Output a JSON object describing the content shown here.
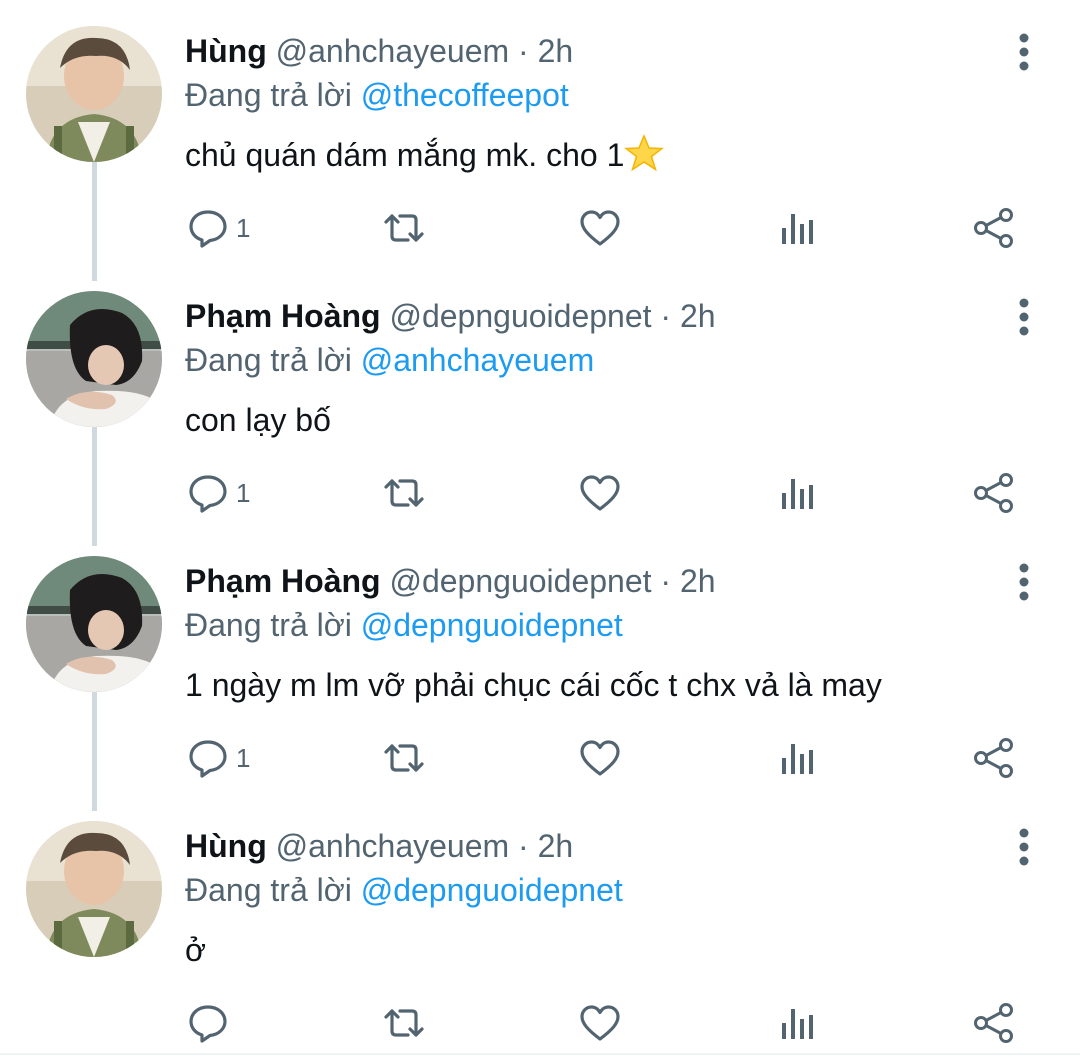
{
  "colors": {
    "text": "#0f1419",
    "secondary": "#536471",
    "link": "#1d9bf0",
    "thread_line": "#cfd9de"
  },
  "tweets": [
    {
      "name": "Hùng",
      "handle": "@anhchayeuem",
      "separator": "·",
      "time": "2h",
      "reply_prefix": "Đang trả lời",
      "reply_to": "@thecoffeepot",
      "text": "chủ quán dám mắng mk. cho 1",
      "text_emoji": "star-emoji",
      "reply_count": "1",
      "avatar": "avatar-hung"
    },
    {
      "name": "Phạm Hoàng",
      "handle": "@depnguoidepnet",
      "separator": "·",
      "time": "2h",
      "reply_prefix": "Đang trả lời",
      "reply_to": "@anhchayeuem",
      "text": "con lạy bố",
      "reply_count": "1",
      "avatar": "avatar-pham-hoang"
    },
    {
      "name": "Phạm Hoàng",
      "handle": "@depnguoidepnet",
      "separator": "·",
      "time": "2h",
      "reply_prefix": "Đang trả lời",
      "reply_to": "@depnguoidepnet",
      "text": "1 ngày m lm vỡ phải chục cái cốc t chx vả là may",
      "reply_count": "1",
      "avatar": "avatar-pham-hoang"
    },
    {
      "name": "Hùng",
      "handle": "@anhchayeuem",
      "separator": "·",
      "time": "2h",
      "reply_prefix": "Đang trả lời",
      "reply_to": "@depnguoidepnet",
      "text": "ở",
      "reply_count": "",
      "avatar": "avatar-hung"
    }
  ],
  "icons": {
    "reply": "reply-icon",
    "retweet": "retweet-icon",
    "like": "heart-icon",
    "analytics": "analytics-icon",
    "share": "share-icon",
    "more": "more-vertical-icon"
  }
}
